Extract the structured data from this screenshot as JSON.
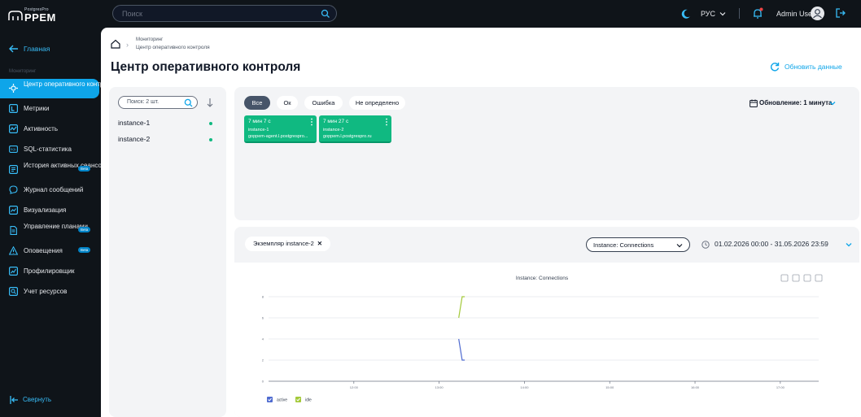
{
  "app": {
    "logo_sub": "PostgresPro",
    "logo_main": "PPEM",
    "search_placeholder": "Поиск",
    "language": "РУС",
    "user_name": "Admin User"
  },
  "sidebar": {
    "home_label": "Главная",
    "section_label": "Мониторинг",
    "items": [
      {
        "label": "Центр оперативного контроля",
        "active": true
      },
      {
        "label": "Метрики"
      },
      {
        "label": "Активность"
      },
      {
        "label": "SQL-статистика"
      },
      {
        "label": "История активных сеансов",
        "badge": "Beta"
      },
      {
        "label": "Журнал сообщений"
      },
      {
        "label": "Визуализация"
      },
      {
        "label": "Управление планами",
        "badge": "Beta"
      },
      {
        "label": "Оповещения",
        "badge": "Beta"
      },
      {
        "label": "Профилировщик"
      },
      {
        "label": "Учет ресурсов"
      }
    ],
    "collapse_label": "Свернуть"
  },
  "breadcrumb": {
    "level1": "Мониторинг",
    "level2": "Центр оперативного контроля"
  },
  "page": {
    "title": "Центр оперативного контроля",
    "refresh_label": "Обновить данные"
  },
  "instances_panel": {
    "search_placeholder": "Поиск: 2 шт.",
    "instances": [
      {
        "name": "instance-1",
        "status_color": "#10b981"
      },
      {
        "name": "instance-2",
        "status_color": "#10b981"
      }
    ]
  },
  "status_panel": {
    "filters": [
      "Все",
      "Ок",
      "Ошибка",
      "Не определено"
    ],
    "selected_filter": "Все",
    "update_label": "Обновление: 1 минута",
    "cards": [
      {
        "duration": "7 мин 7 с",
        "instance": "instance-1",
        "host": "goppem-agent.l.postgrespro..."
      },
      {
        "duration": "7 мин 27 с",
        "instance": "instance-2",
        "host": "goppem.l.postgrespro.ru"
      }
    ]
  },
  "chart_panel": {
    "instance_tag": "Экземпляр instance-2",
    "metric_select": "Instance: Connections",
    "date_range": "01.02.2026 00:00 - 31.05.2026 23:59"
  },
  "chart_data": {
    "type": "line",
    "title": "Instance: Connections",
    "x_ticks": [
      "12:00",
      "13:00",
      "14:00",
      "15:00",
      "16:00",
      "17:00"
    ],
    "y_ticks": [
      0,
      2,
      4,
      6,
      8
    ],
    "ylim": [
      0,
      8
    ],
    "x_unit": "hours",
    "xlim": [
      11.0,
      17.45
    ],
    "series": [
      {
        "name": "active",
        "color": "#4f6bd0",
        "points": [
          [
            13.23,
            4
          ],
          [
            13.27,
            2
          ],
          [
            13.3,
            2
          ]
        ]
      },
      {
        "name": "idle",
        "color": "#a3c93a",
        "points": [
          [
            13.23,
            6
          ],
          [
            13.27,
            8
          ],
          [
            13.3,
            8
          ]
        ]
      }
    ],
    "legend_position": "bottom-left",
    "grid": true
  }
}
